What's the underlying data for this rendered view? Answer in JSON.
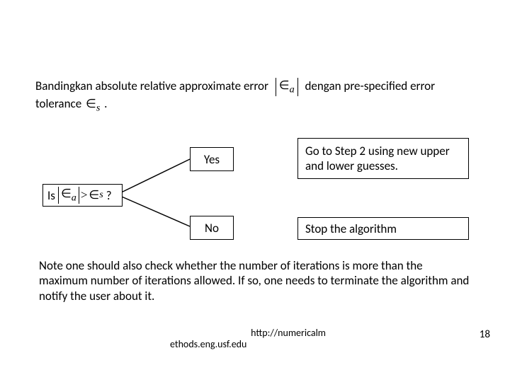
{
  "intro": {
    "pre": "Bandingkan absolute relative approximate error",
    "mid": "dengan pre-specified error",
    "post_a": "tolerance",
    "post_b": "."
  },
  "decision": {
    "is": "Is",
    "q": "?",
    "yes": "Yes",
    "no": "No",
    "yes_action": "Go to Step 2 using new upper and lower guesses.",
    "no_action": "Stop the algorithm"
  },
  "note": "Note one should also check whether the number of iterations is more than the maximum number of iterations allowed. If so, one needs to terminate the algorithm and notify the user about it.",
  "footer": {
    "url_line1": "http://numericalm",
    "url_line2": "ethods.eng.usf.edu",
    "slide": "18"
  }
}
